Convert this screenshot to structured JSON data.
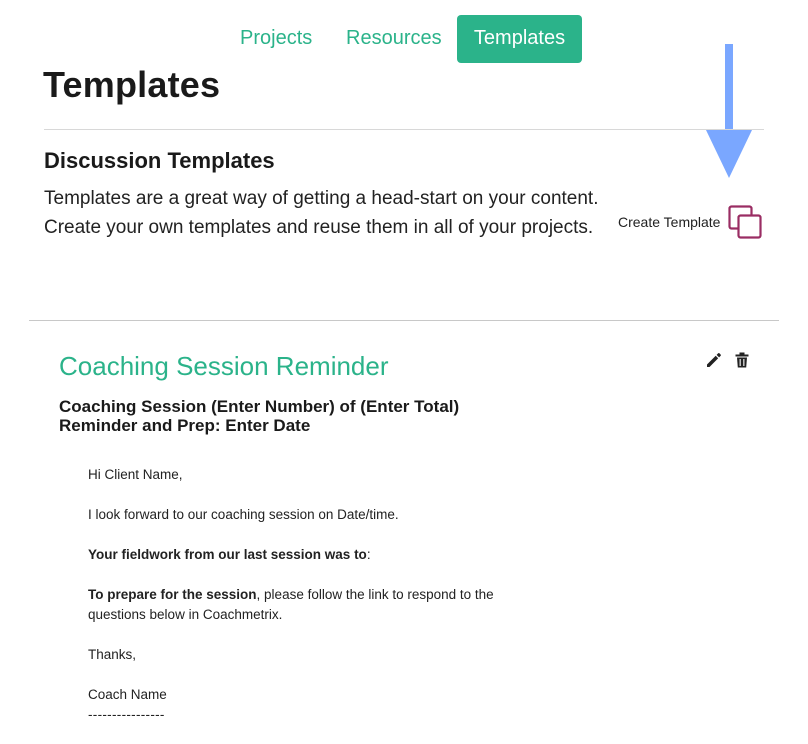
{
  "nav": {
    "projects": "Projects",
    "resources": "Resources",
    "templates": "Templates"
  },
  "page": {
    "title": "Templates",
    "section_title": "Discussion Templates",
    "section_description": "Templates are a great way of getting a head-start on your content. Create your own templates and reuse them in all of your projects.",
    "create_template_label": "Create Template",
    "create_template_icon": "copy-icon"
  },
  "template": {
    "title": "Coaching Session Reminder",
    "subject_line1": "Coaching Session (Enter Number) of (Enter Total)",
    "subject_line2": "Reminder and Prep: Enter Date",
    "body": {
      "greeting": "Hi Client Name,",
      "line1": "I look forward to our coaching session on Date/time.",
      "fieldwork_bold": "Your fieldwork from our last session was to",
      "fieldwork_rest": ":",
      "prepare_bold": "To prepare for the session",
      "prepare_rest": ", please follow the link to respond to the questions below in Coachmetrix.",
      "thanks": "Thanks,",
      "signature": "Coach Name",
      "divider": "----------------"
    }
  },
  "colors": {
    "accent": "#2bb38a",
    "create_icon": "#9a2d63",
    "arrow": "#7aa7ff"
  },
  "icons": {
    "edit": "pencil-icon",
    "delete": "trash-icon"
  }
}
